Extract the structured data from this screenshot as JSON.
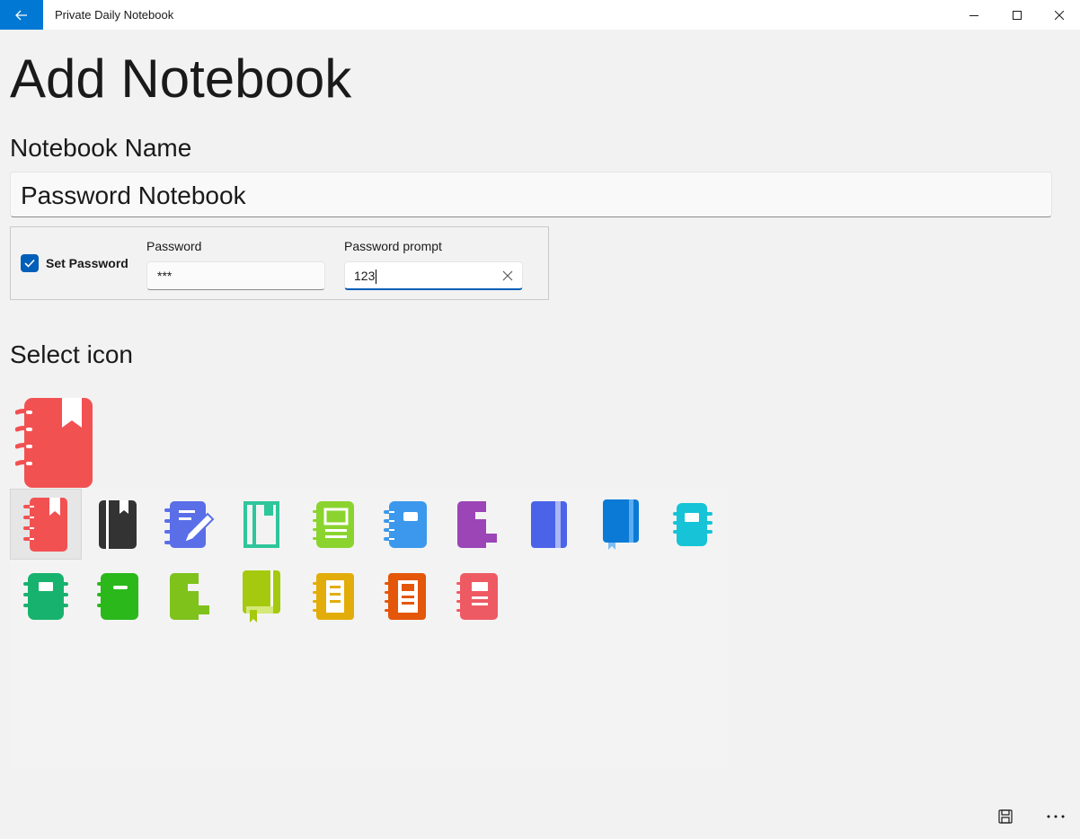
{
  "window": {
    "title": "Private Daily Notebook"
  },
  "page": {
    "title": "Add Notebook",
    "name_label": "Notebook Name",
    "name_value": "Password Notebook",
    "set_password_label": "Set Password",
    "set_password_checked": true,
    "password_label": "Password",
    "password_value": "***",
    "prompt_label": "Password prompt",
    "prompt_value": "123",
    "select_icon_label": "Select icon"
  },
  "icons": [
    {
      "name": "red-bookmark-notebook",
      "color": "#f25152"
    },
    {
      "name": "black-notebook",
      "color": "#333333"
    },
    {
      "name": "blue-pencil-notebook",
      "color": "#5a6ee8"
    },
    {
      "name": "teal-outline-notebook",
      "color": "#2ec69b"
    },
    {
      "name": "lime-notebook",
      "color": "#8bd32f"
    },
    {
      "name": "sky-blue-notebook",
      "color": "#3b98ec"
    },
    {
      "name": "purple-notebook",
      "color": "#9b45b7"
    },
    {
      "name": "indigo-notebook",
      "color": "#4a63e8"
    },
    {
      "name": "blue-journal",
      "color": "#0a7ad6"
    },
    {
      "name": "cyan-notebook",
      "color": "#17c3d6"
    },
    {
      "name": "green-notebook",
      "color": "#17b36e"
    },
    {
      "name": "bright-green-notebook",
      "color": "#2ab81b"
    },
    {
      "name": "lime-green-notebook",
      "color": "#7ec21b"
    },
    {
      "name": "olive-journal",
      "color": "#a5c90e"
    },
    {
      "name": "amber-notebook",
      "color": "#e2ad0a"
    },
    {
      "name": "orange-notebook",
      "color": "#e4560a"
    },
    {
      "name": "coral-notebook",
      "color": "#ee5a63"
    }
  ],
  "selected_icon_index": 0,
  "commands": {
    "save": "save-icon",
    "more": "more-icon"
  }
}
